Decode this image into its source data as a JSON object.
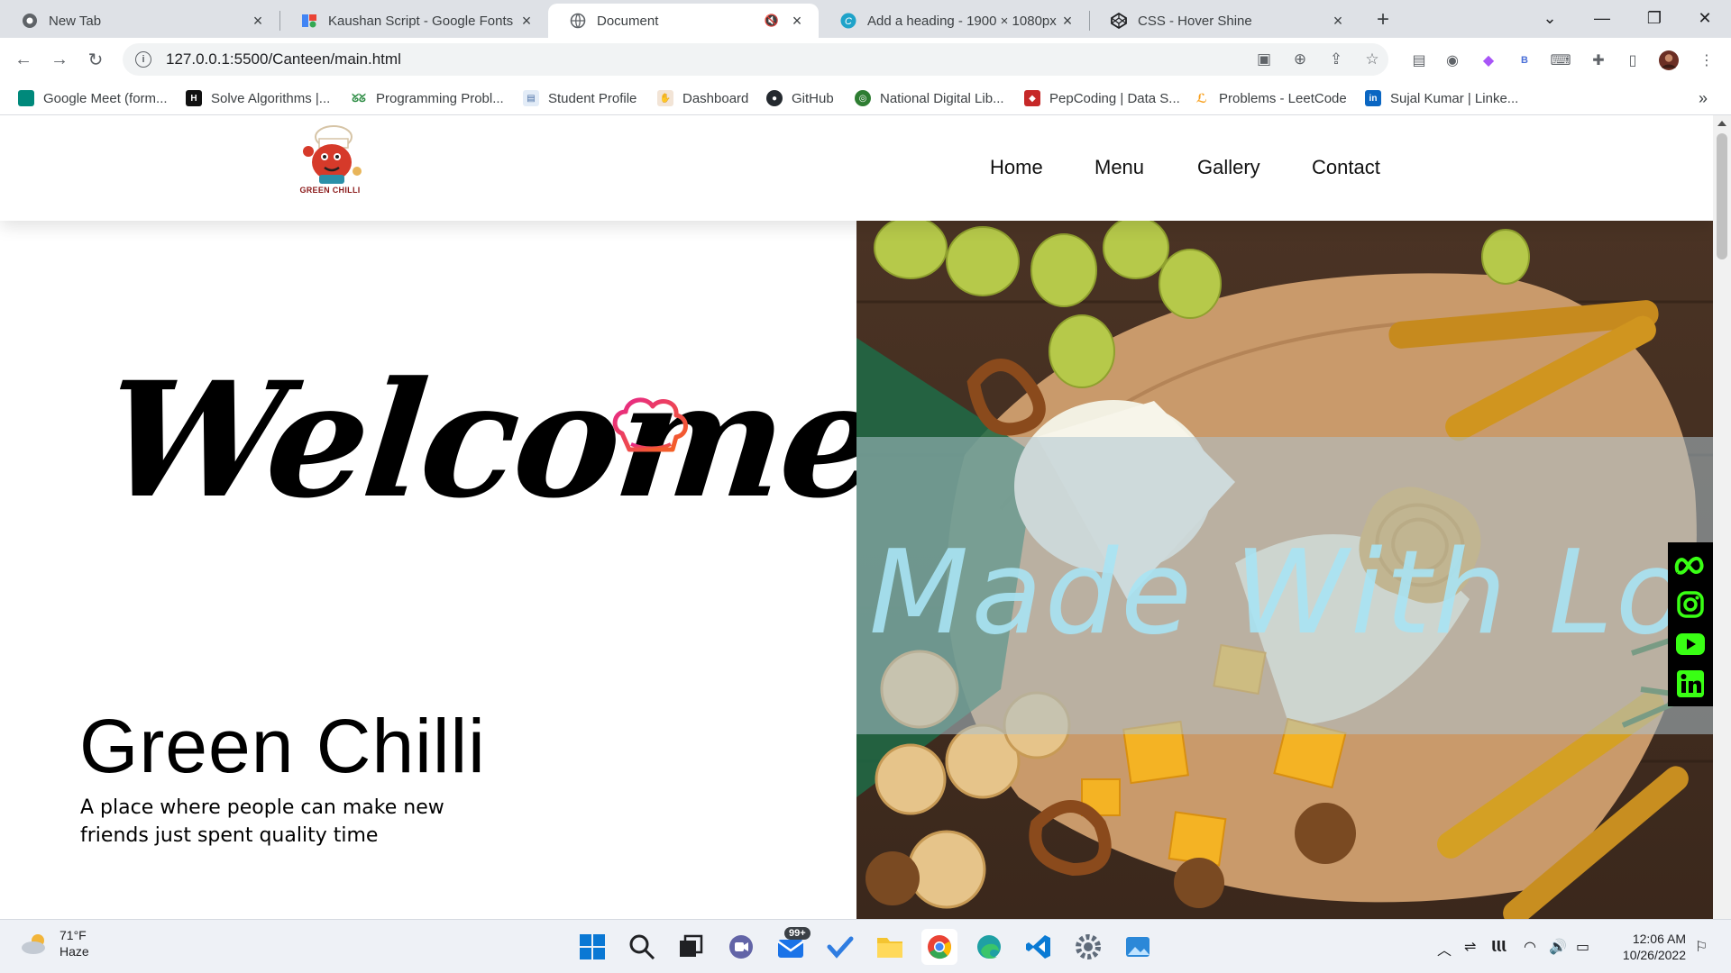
{
  "browser": {
    "tabs": [
      {
        "title": "New Tab",
        "active": false
      },
      {
        "title": "Kaushan Script - Google Fonts",
        "active": false
      },
      {
        "title": "Document",
        "active": true
      },
      {
        "title": "Add a heading - 1900 × 1080px",
        "active": false
      },
      {
        "title": "CSS - Hover Shine",
        "active": false
      }
    ],
    "url": "127.0.0.1:5500/Canteen/main.html",
    "bookmarks": [
      {
        "label": "Google Meet (form...",
        "icon": "google-meet-icon",
        "color": "#00897b"
      },
      {
        "label": "Solve Algorithms |...",
        "icon": "hackerrank-icon",
        "color": "#111111"
      },
      {
        "label": "Programming Probl...",
        "icon": "geeksforgeeks-icon",
        "color": "#2f8d46"
      },
      {
        "label": "Student Profile",
        "icon": "document-icon",
        "color": "#4a6fa5"
      },
      {
        "label": "Dashboard",
        "icon": "dashboard-icon",
        "color": "#b07a4a"
      },
      {
        "label": "GitHub",
        "icon": "github-icon",
        "color": "#24292f"
      },
      {
        "label": "National Digital Lib...",
        "icon": "library-icon",
        "color": "#2e7d32"
      },
      {
        "label": "PepCoding | Data S...",
        "icon": "pepcoding-icon",
        "color": "#c62828"
      },
      {
        "label": "Problems - LeetCode",
        "icon": "leetcode-icon",
        "color": "#f89f1b"
      },
      {
        "label": "Sujal Kumar | Linke...",
        "icon": "linkedin-icon",
        "color": "#0a66c2"
      }
    ]
  },
  "site": {
    "logo_text": "GREEN CHILLI",
    "nav": [
      "Home",
      "Menu",
      "Gallery",
      "Contact"
    ],
    "welcome": "Welcome",
    "brand": "Green Chilli",
    "tagline": "A place where people can make new friends just spent quality time",
    "hero_text": "Made With Love",
    "social": [
      "meta-icon",
      "instagram-icon",
      "youtube-icon",
      "linkedin-icon"
    ],
    "accent": "#00ff00"
  },
  "taskbar": {
    "weather_temp": "71°F",
    "weather_desc": "Haze",
    "mail_badge": "99+",
    "time": "12:06 AM",
    "date": "10/26/2022"
  }
}
